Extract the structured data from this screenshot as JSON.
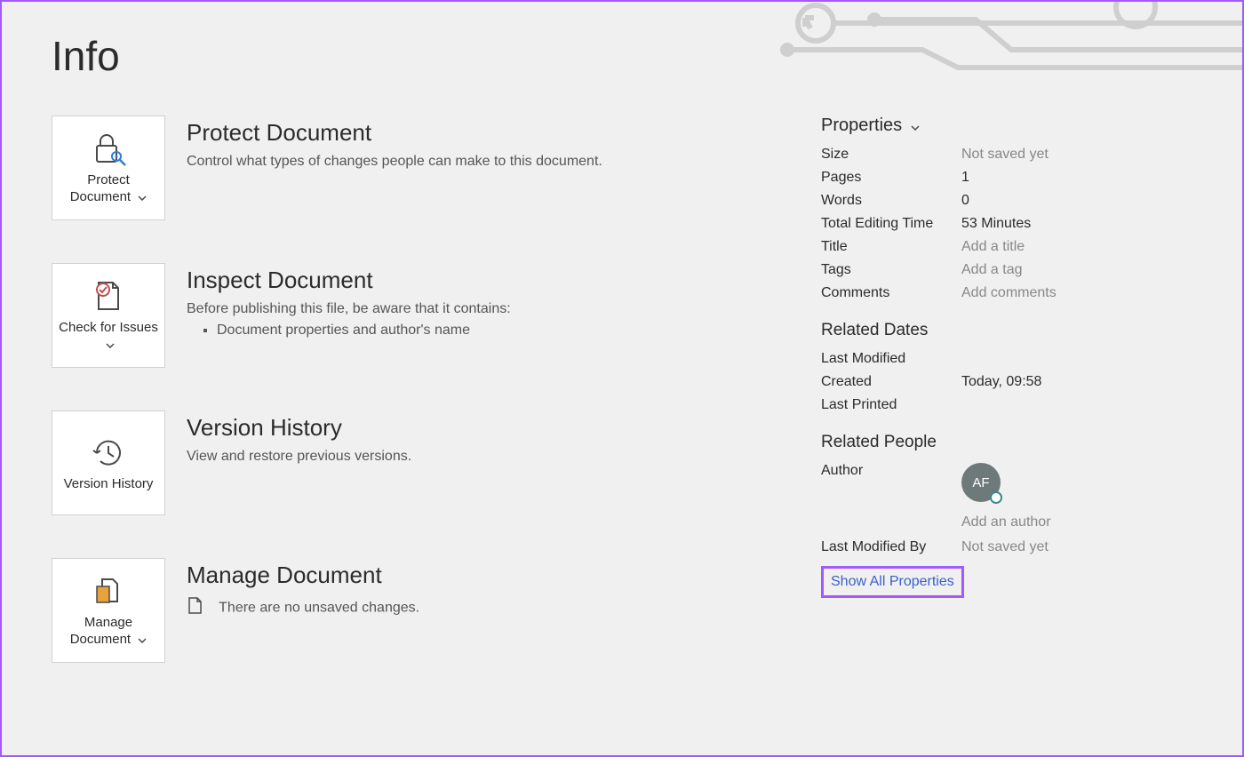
{
  "page": {
    "title": "Info"
  },
  "actions": {
    "protect": {
      "tile_label": "Protect Document",
      "heading": "Protect Document",
      "desc": "Control what types of changes people can make to this document."
    },
    "inspect": {
      "tile_label": "Check for Issues",
      "heading": "Inspect Document",
      "desc": "Before publishing this file, be aware that it contains:",
      "bullet1": "Document properties and author's name"
    },
    "version": {
      "tile_label": "Version History",
      "heading": "Version History",
      "desc": "View and restore previous versions."
    },
    "manage": {
      "tile_label": "Manage Document",
      "heading": "Manage Document",
      "desc": "There are no unsaved changes."
    }
  },
  "properties": {
    "heading": "Properties",
    "size_label": "Size",
    "size_value": "Not saved yet",
    "pages_label": "Pages",
    "pages_value": "1",
    "words_label": "Words",
    "words_value": "0",
    "editing_label": "Total Editing Time",
    "editing_value": "53 Minutes",
    "title_label": "Title",
    "title_placeholder": "Add a title",
    "tags_label": "Tags",
    "tags_placeholder": "Add a tag",
    "comments_label": "Comments",
    "comments_placeholder": "Add comments"
  },
  "related_dates": {
    "heading": "Related Dates",
    "last_modified_label": "Last Modified",
    "last_modified_value": "",
    "created_label": "Created",
    "created_value": "Today, 09:58",
    "last_printed_label": "Last Printed",
    "last_printed_value": ""
  },
  "related_people": {
    "heading": "Related People",
    "author_label": "Author",
    "author_initials": "AF",
    "add_author": "Add an author",
    "last_modified_by_label": "Last Modified By",
    "last_modified_by_value": "Not saved yet"
  },
  "show_all": "Show All Properties"
}
